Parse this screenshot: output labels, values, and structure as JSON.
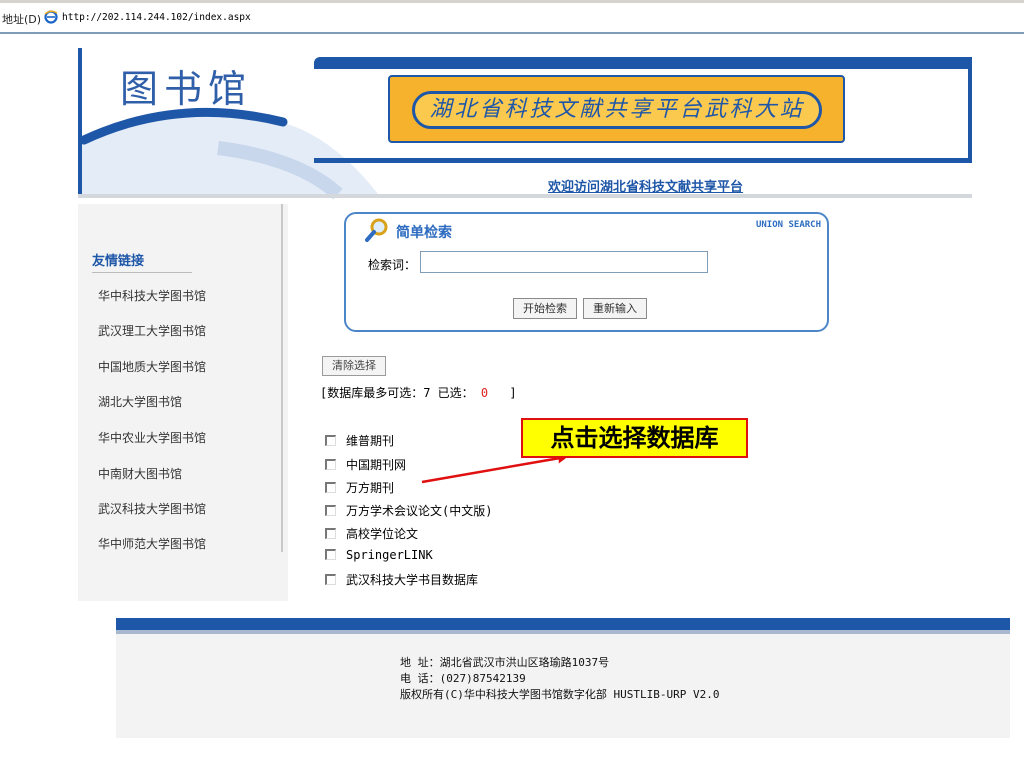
{
  "address_bar": {
    "label": "地址(D)",
    "url": "http://202.114.244.102/index.aspx"
  },
  "header": {
    "logo_text": "图书馆",
    "banner_text": "湖北省科技文献共享平台武科大站",
    "welcome_link": "欢迎访问湖北省科技文献共享平台"
  },
  "sidebar": {
    "title": "友情链接",
    "links": [
      "华中科技大学图书馆",
      "武汉理工大学图书馆",
      "中国地质大学图书馆",
      "湖北大学图书馆",
      "华中农业大学图书馆",
      "中南财大图书馆",
      "武汉科技大学图书馆",
      "华中师范大学图书馆"
    ]
  },
  "search": {
    "title": "简单检索",
    "union_label": "UNION SEARCH",
    "keyword_label": "检索词：",
    "keyword_value": "",
    "start_button": "开始检索",
    "reset_button": "重新输入"
  },
  "databases": {
    "clear_button": "清除选择",
    "limit_prefix": "[数据库最多可选：7 已选：",
    "selected_count": "0",
    "limit_suffix": "]",
    "items": [
      "维普期刊",
      "中国期刊网",
      "万方期刊",
      "万方学术会议论文(中文版)",
      "高校学位论文",
      "SpringerLINK",
      "武汉科技大学书目数据库"
    ]
  },
  "annotation": {
    "callout_text": "点击选择数据库",
    "callout_bg": "#ffff00",
    "callout_border": "#e01010"
  },
  "footer": {
    "address": "地  址：湖北省武汉市洪山区珞瑜路1037号",
    "phone": "电  话：(027)87542139",
    "copyright": "版权所有(C)华中科技大学图书馆数字化部 HUSTLIB-URP V2.0"
  },
  "colors": {
    "brand_blue": "#1f57a8",
    "banner_orange": "#f6b22d"
  }
}
